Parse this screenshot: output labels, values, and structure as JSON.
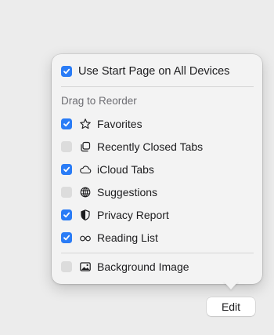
{
  "colors": {
    "accent": "#2a7cf6",
    "unchecked": "#dcdcdc",
    "popover_bg": "#f3f3f3",
    "background": "#ececec"
  },
  "popover": {
    "start_page_option": {
      "label": "Use Start Page on All Devices",
      "checked": true
    },
    "section_label": "Drag to Reorder",
    "items": [
      {
        "label": "Favorites",
        "checked": true,
        "icon": "star-icon"
      },
      {
        "label": "Recently Closed Tabs",
        "checked": false,
        "icon": "recently-closed-tabs-icon"
      },
      {
        "label": "iCloud Tabs",
        "checked": true,
        "icon": "cloud-icon"
      },
      {
        "label": "Suggestions",
        "checked": false,
        "icon": "globe-icon"
      },
      {
        "label": "Privacy Report",
        "checked": true,
        "icon": "shield-icon"
      },
      {
        "label": "Reading List",
        "checked": true,
        "icon": "glasses-icon"
      }
    ],
    "background_image_option": {
      "label": "Background Image",
      "checked": false,
      "icon": "photo-icon"
    }
  },
  "edit_button": {
    "label": "Edit"
  }
}
